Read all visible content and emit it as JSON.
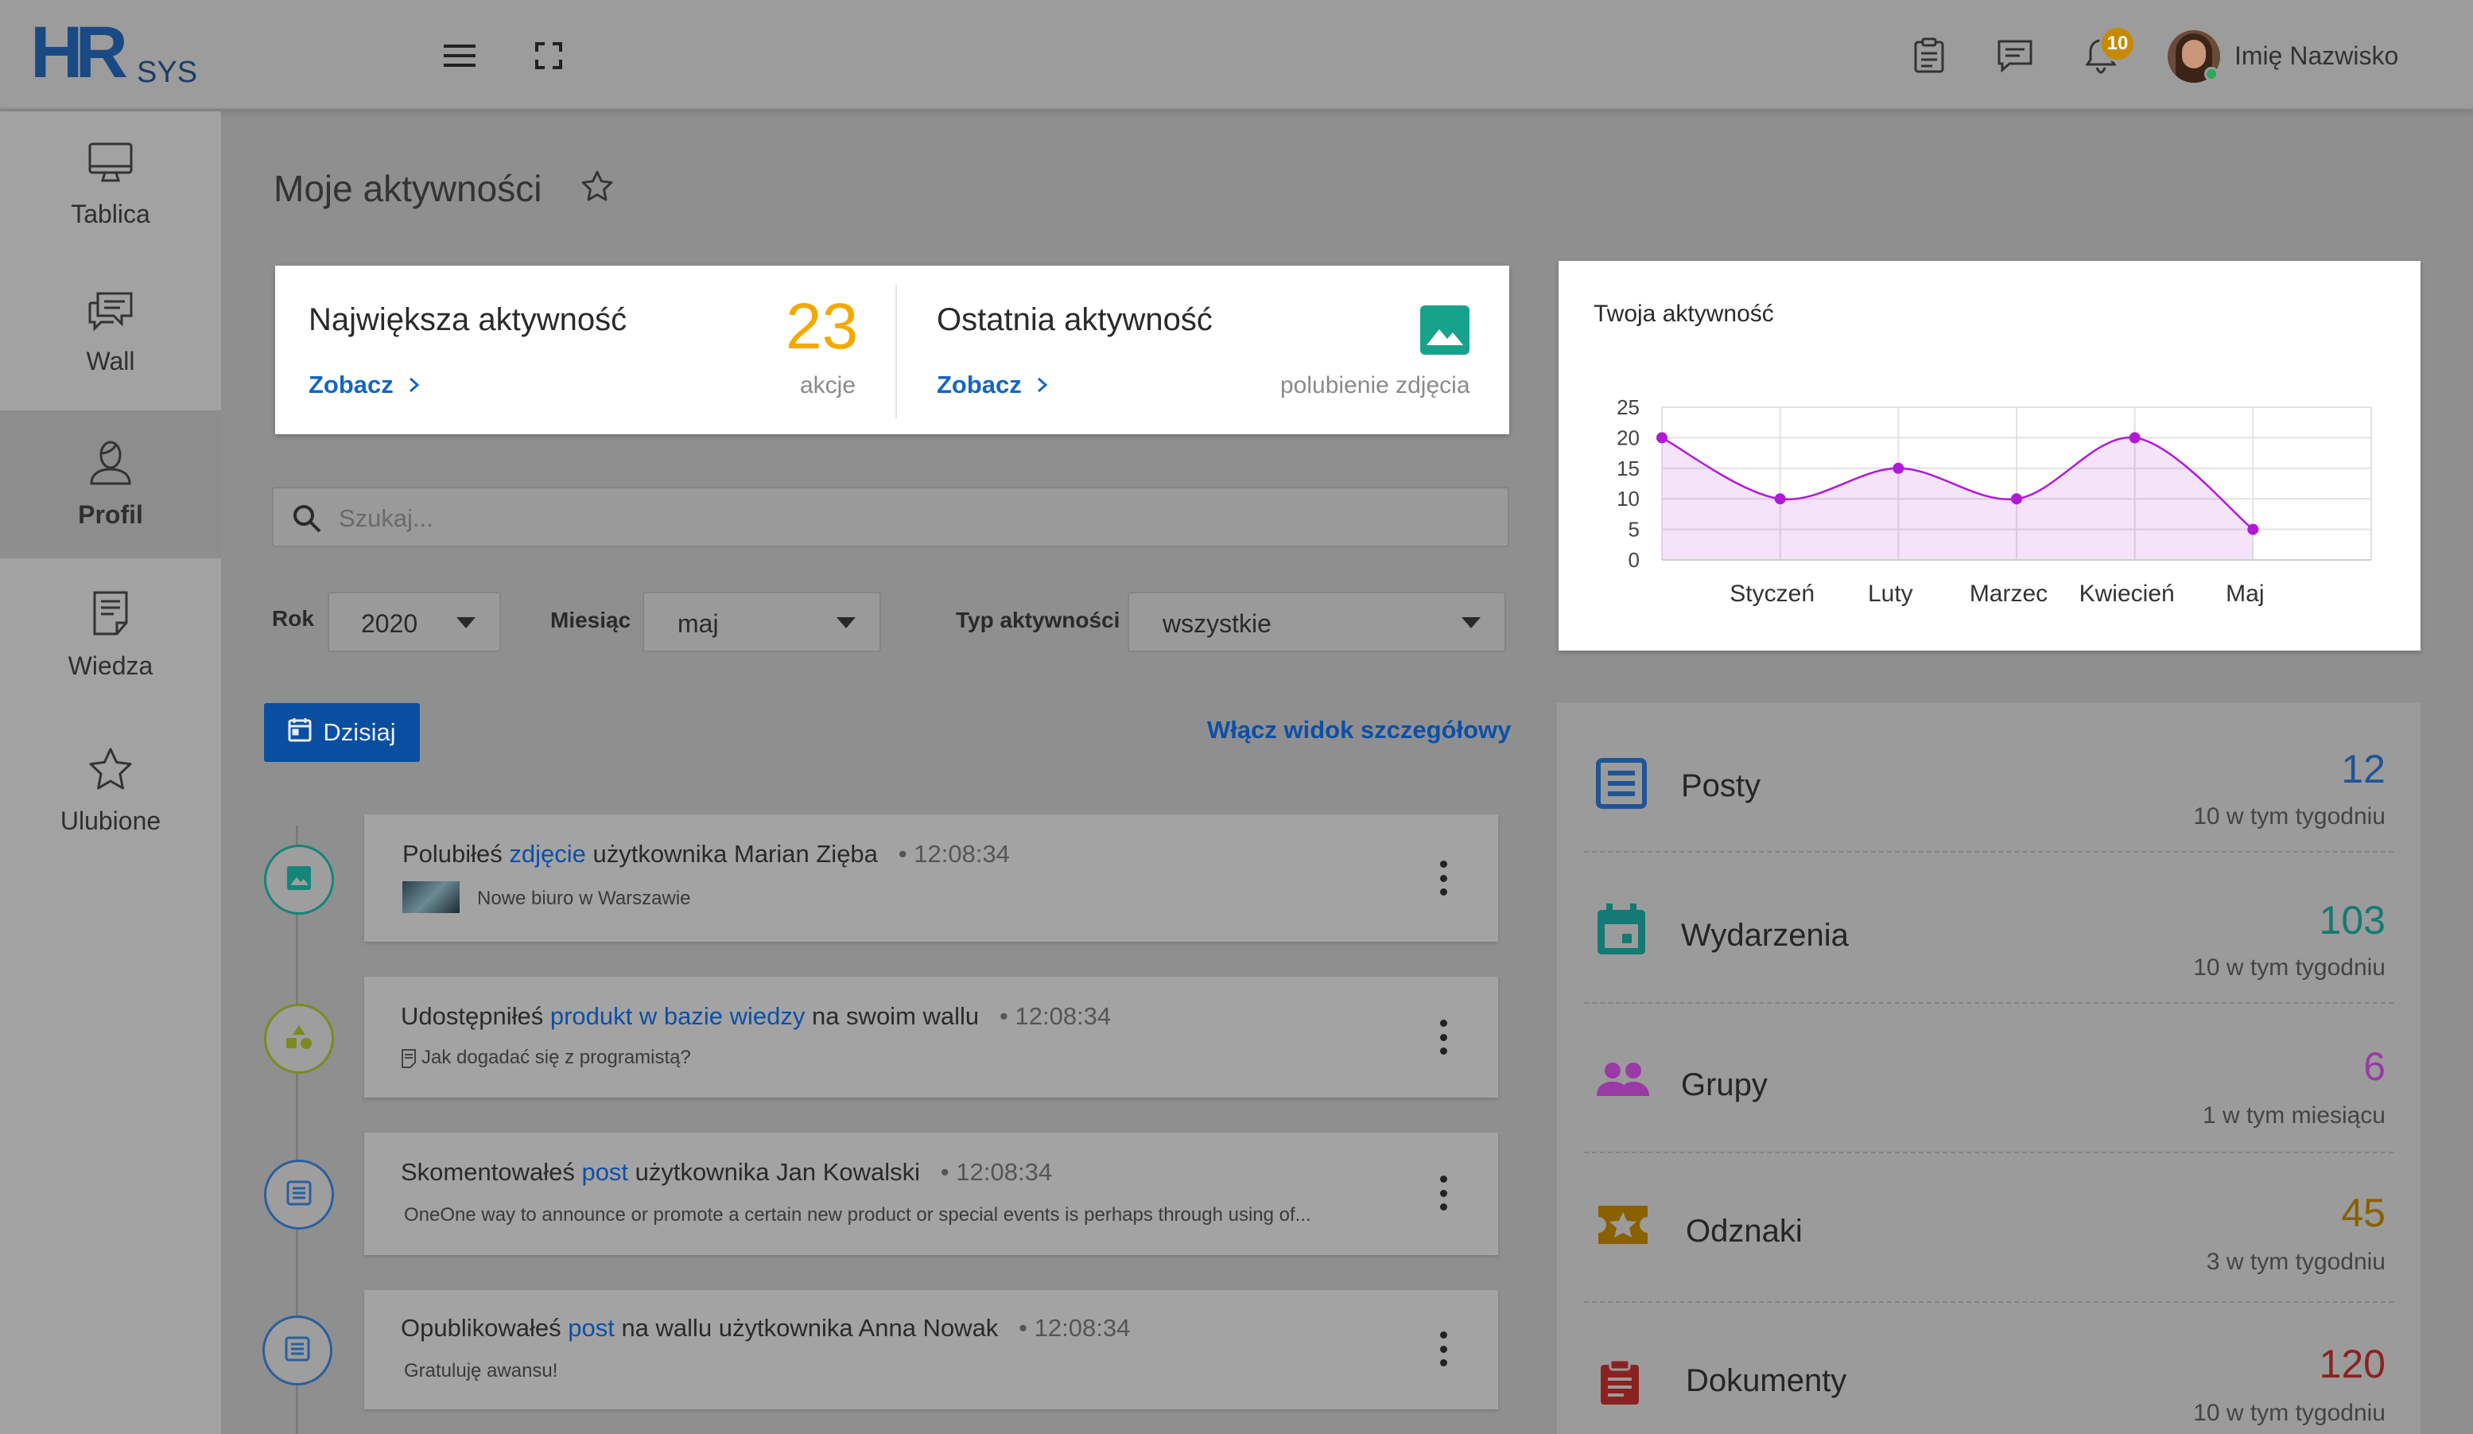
{
  "brand": {
    "logo_main": "HR",
    "logo_sub": "SYS"
  },
  "header": {
    "notification_count": "10",
    "user_name": "Imię Nazwisko",
    "icons": [
      "menu-icon",
      "fullscreen-icon",
      "clipboard-icon",
      "chat-icon",
      "bell-icon"
    ]
  },
  "sidebar": {
    "items": [
      {
        "label": "Tablica",
        "icon": "monitor-icon",
        "active": false
      },
      {
        "label": "Wall",
        "icon": "chat-bubbles-icon",
        "active": false
      },
      {
        "label": "Profil",
        "icon": "user-icon",
        "active": true
      },
      {
        "label": "Wiedza",
        "icon": "document-icon",
        "active": false
      },
      {
        "label": "Ulubione",
        "icon": "star-icon",
        "active": false
      }
    ]
  },
  "page": {
    "title": "Moje aktywności"
  },
  "top_stats": {
    "biggest": {
      "title": "Największa aktywność",
      "link": "Zobacz",
      "value": "23",
      "unit": "akcje"
    },
    "last": {
      "title": "Ostatnia aktywność",
      "link": "Zobacz",
      "desc": "polubienie zdjęcia"
    }
  },
  "search": {
    "placeholder": "Szukaj..."
  },
  "filters": {
    "year": {
      "label": "Rok",
      "value": "2020"
    },
    "month": {
      "label": "Miesiąc",
      "value": "maj"
    },
    "type": {
      "label": "Typ aktywności",
      "value": "wszystkie"
    }
  },
  "timeline": {
    "today_label": "Dzisiaj",
    "detail_link": "Włącz widok szczegółowy",
    "activities": [
      {
        "pre": "Polubiłeś ",
        "link": "zdjęcie",
        "post": " użytkownika Marian Zięba",
        "time": "12:08:34",
        "sub": "Nowe biuro w Warszawie",
        "icon": "image-icon",
        "color": "#13857a"
      },
      {
        "pre": "Udostępniłeś ",
        "link": "produkt w bazie wiedzy",
        "post": " na swoim wallu",
        "time": "12:08:34",
        "sub": "Jak dogadać się z programistą?",
        "icon": "shapes-icon",
        "color": "#7c8a1e"
      },
      {
        "pre": "Skomentowałeś ",
        "link": "post",
        "post": " użytkownika Jan Kowalski",
        "time": "12:08:34",
        "sub": "OneOne way to announce or promote a certain new product or special events is perhaps through using of...",
        "icon": "post-icon",
        "color": "#2a5f9e"
      },
      {
        "pre": "Opublikowałeś ",
        "link": "post",
        "post": " na wallu użytkownika Anna Nowak",
        "time": "12:08:34",
        "sub": "Gratuluję awansu!",
        "icon": "post-icon",
        "color": "#2a5f9e"
      }
    ]
  },
  "chart_data": {
    "type": "area",
    "title": "Twoja aktywność",
    "x": [
      "",
      "Styczeń",
      "Luty",
      "Marzec",
      "Kwiecień",
      "Maj"
    ],
    "series": [
      {
        "values": [
          20,
          10,
          15,
          10,
          20,
          5
        ]
      }
    ],
    "ylim": [
      0,
      25
    ],
    "yticks": [
      0,
      5,
      10,
      15,
      20,
      25
    ],
    "grid": true,
    "color": "#b01ad6"
  },
  "summary": {
    "rows": [
      {
        "name": "Posty",
        "value": "12",
        "sub": "10 w tym tygodniu",
        "color": "#1f5596",
        "icon": "list-icon"
      },
      {
        "name": "Wydarzenia",
        "value": "103",
        "sub": "10 w tym tygodniu",
        "color": "#137a74",
        "icon": "calendar-icon"
      },
      {
        "name": "Grupy",
        "value": "6",
        "sub": "1 w tym miesiącu",
        "color": "#9a3aa6",
        "icon": "group-icon"
      },
      {
        "name": "Odznaki",
        "value": "45",
        "sub": "3 w tym tygodniu",
        "color": "#8a6000",
        "icon": "badge-icon"
      },
      {
        "name": "Dokumenty",
        "value": "120",
        "sub": "10 w tym tygodniu",
        "color": "#8a2222",
        "icon": "clipboard-icon"
      }
    ]
  }
}
